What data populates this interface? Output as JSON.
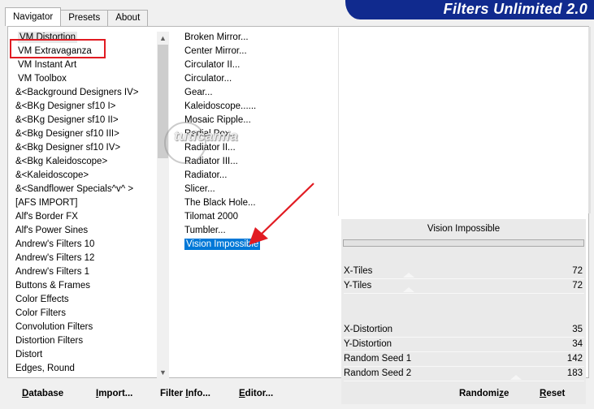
{
  "tabs": [
    {
      "label": "Navigator"
    },
    {
      "label": "Presets"
    },
    {
      "label": "About"
    }
  ],
  "banner": {
    "title": "Filters Unlimited 2.0"
  },
  "categories": [
    "VM Distortion",
    "VM Extravaganza",
    "VM Instant Art",
    "VM Toolbox",
    "&<Background Designers IV>",
    "&<BKg Designer sf10 I>",
    "&<BKg Designer sf10 II>",
    "&<Bkg Designer sf10 III>",
    "&<Bkg Designer sf10 IV>",
    "&<Bkg Kaleidoscope>",
    "&<Kaleidoscope>",
    "&<Sandflower Specials^v^ >",
    "[AFS IMPORT]",
    "Alf's Border FX",
    "Alf's Power Sines",
    "Andrew's Filters 10",
    "Andrew's Filters 12",
    "Andrew's Filters 1",
    "Buttons & Frames",
    "Color Effects",
    "Color Filters",
    "Convolution Filters",
    "Distortion Filters",
    "Distort",
    "Edges, Round"
  ],
  "filters": [
    "Broken Mirror...",
    "Center Mirror...",
    "Circulator II...",
    "Circulator...",
    "Gear...",
    "Kaleidoscope......",
    "Mosaic Ripple...",
    "Radial Pox...",
    "Radiator II...",
    "Radiator III...",
    "Radiator...",
    "Slicer...",
    "The Black Hole...",
    "Tilomat 2000",
    "Tumbler...",
    "Vision Impossible"
  ],
  "watermark": "tuticamia",
  "params": {
    "title": "Vision Impossible",
    "rows": [
      {
        "name": "X-Tiles",
        "value": "72"
      },
      {
        "name": "Y-Tiles",
        "value": "72"
      },
      {
        "name": "X-Distortion",
        "value": "35"
      },
      {
        "name": "Y-Distortion",
        "value": "34"
      },
      {
        "name": "Random Seed 1",
        "value": "142"
      },
      {
        "name": "Random Seed 2",
        "value": "183"
      }
    ]
  },
  "buttons": {
    "database_hot": "D",
    "database_rest": "atabase",
    "import_hot": "I",
    "import_rest": "mport...",
    "filterinfo_pre": "Filter ",
    "filterinfo_hot": "I",
    "filterinfo_rest": "nfo...",
    "editor_hot": "E",
    "editor_rest": "ditor...",
    "randomize_pre": "Randomi",
    "randomize_hot": "z",
    "randomize_rest": "e",
    "reset_hot": "R",
    "reset_rest": "eset"
  },
  "colors": {
    "banner": "#102a8e",
    "selection": "#0078d7",
    "annotation": "#e11b22"
  }
}
